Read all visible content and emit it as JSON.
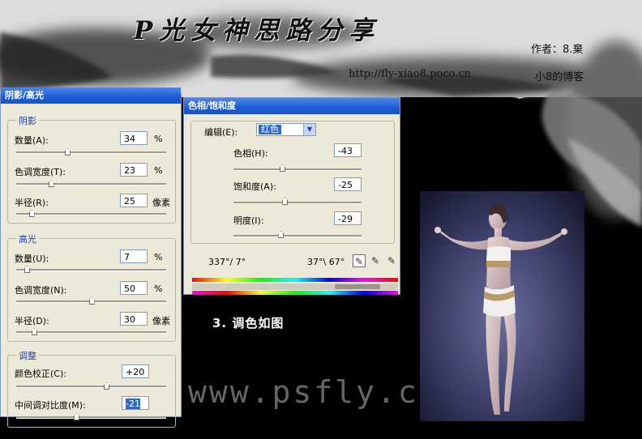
{
  "header": {
    "title": "PS光女神思路分享",
    "title_display": "P光女神思路分享",
    "author": "作者：8.棄",
    "url": "http://fly-xiao8.poco.cn",
    "blog": "小8的博客"
  },
  "shadow_highlight_dialog": {
    "title": "阴影/高光",
    "shadows": {
      "caption": "阴影",
      "amount": {
        "label": "数量(A):",
        "value": "34",
        "unit": "%",
        "slider": 0.34
      },
      "tonal_width": {
        "label": "色调宽度(T):",
        "value": "23",
        "unit": "%",
        "slider": 0.23
      },
      "radius": {
        "label": "半径(R):",
        "value": "25",
        "unit": "像素",
        "slider": 0.1
      }
    },
    "highlights": {
      "caption": "高光",
      "amount": {
        "label": "数量(U):",
        "value": "7",
        "unit": "%",
        "slider": 0.07
      },
      "tonal_width": {
        "label": "色调宽度(N):",
        "value": "50",
        "unit": "%",
        "slider": 0.5
      },
      "radius": {
        "label": "半径(D):",
        "value": "30",
        "unit": "像素",
        "slider": 0.12
      }
    },
    "adjustments": {
      "caption": "调整",
      "color_correction": {
        "label": "颜色校正(C):",
        "value": "+20",
        "slider": 0.6
      },
      "midtone_contrast": {
        "label": "中间调对比度(M):",
        "value": "-21",
        "slider": 0.4
      }
    }
  },
  "hue_saturation_dialog": {
    "title": "色相/饱和度",
    "edit_label": "编辑(E):",
    "edit_value": "红色",
    "hue": {
      "label": "色相(H):",
      "value": "-43",
      "slider": 0.38
    },
    "saturation": {
      "label": "饱和度(A):",
      "value": "-25",
      "slider": 0.4
    },
    "lightness": {
      "label": "明度(I):",
      "value": "-29",
      "slider": 0.37
    },
    "range_left": "337°/ 7°",
    "range_right": "37°\\ 67°",
    "tools": [
      "eyedropper-icon",
      "eyedropper-plus-icon",
      "eyedropper-minus-icon"
    ]
  },
  "caption": "3. 调色如图",
  "watermark": "www.psfly.com"
}
